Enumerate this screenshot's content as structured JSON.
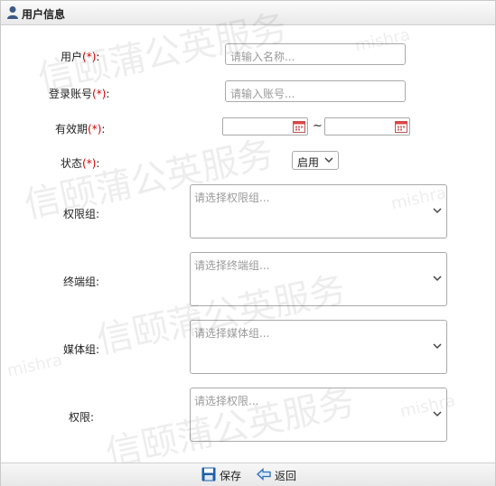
{
  "header": {
    "title": "用户信息",
    "icon": "user-icon"
  },
  "form": {
    "username": {
      "label": "用户",
      "required_mark": "(*)",
      "colon": ":",
      "placeholder": "请输入名称..."
    },
    "account": {
      "label": "登录账号",
      "required_mark": "(*)",
      "colon": ":",
      "placeholder": "请输入账号..."
    },
    "validity": {
      "label": "有效期",
      "required_mark": "(*)",
      "colon": ":",
      "separator": "~",
      "start_value": "",
      "end_value": "",
      "icon": "calendar-icon"
    },
    "status": {
      "label": "状态",
      "required_mark": "(*)",
      "colon": ":",
      "selected": "启用"
    },
    "permission_group": {
      "label": "权限组:",
      "placeholder": "请选择权限组..."
    },
    "terminal_group": {
      "label": "终端组:",
      "placeholder": "请选择终端组..."
    },
    "media_group": {
      "label": "媒体组:",
      "placeholder": "请选择媒体组..."
    },
    "permission": {
      "label": "权限:",
      "placeholder": "请选择权限..."
    }
  },
  "footer": {
    "save_label": "保存",
    "save_icon": "floppy-disk-icon",
    "back_label": "返回",
    "back_icon": "back-arrow-icon"
  },
  "watermark": {
    "text": "信颐蒲公英服务",
    "tag": "mishra"
  },
  "colors": {
    "required": "#d40000",
    "placeholder": "#9a9a9a",
    "border": "#a9a9a9",
    "save_icon": "#1f5fa8",
    "back_icon": "#2a6fc0"
  }
}
